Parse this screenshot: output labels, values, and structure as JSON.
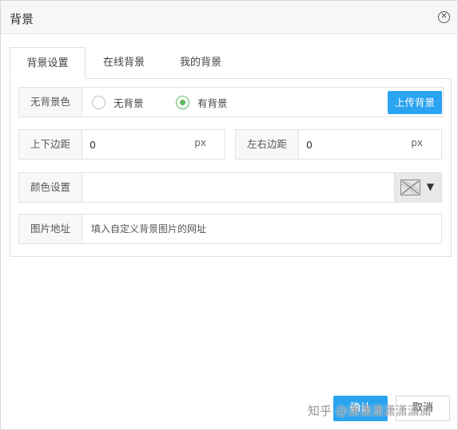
{
  "dialog": {
    "title": "背景",
    "close_icon": "close-circle-icon"
  },
  "tabs": [
    {
      "label": "背景设置",
      "active": true
    },
    {
      "label": "在线背景",
      "active": false
    },
    {
      "label": "我的背景",
      "active": false
    }
  ],
  "background_color": {
    "label": "无背景色",
    "options": [
      {
        "label": "无背景",
        "checked": false
      },
      {
        "label": "有背景",
        "checked": true
      }
    ],
    "upload_label": "上传背景"
  },
  "spacing": {
    "vertical_label": "上下边距",
    "vertical_value": "0",
    "vertical_unit": "px",
    "horizontal_label": "左右边距",
    "horizontal_value": "0",
    "horizontal_unit": "px"
  },
  "color_setting": {
    "label": "颜色设置",
    "value": "",
    "picker_icon": "no-color-swatch-icon",
    "caret_icon": "triangle-down-icon"
  },
  "image_url": {
    "label": "图片地址",
    "placeholder": "填入自定义背景图片的网址"
  },
  "footer": {
    "confirm_label": "确认",
    "cancel_label": "取消"
  },
  "watermark": "知乎 @潇潇潇潇潇潇潇",
  "colors": {
    "accent": "#2aa3f0",
    "radio_checked": "#5cb85c"
  }
}
